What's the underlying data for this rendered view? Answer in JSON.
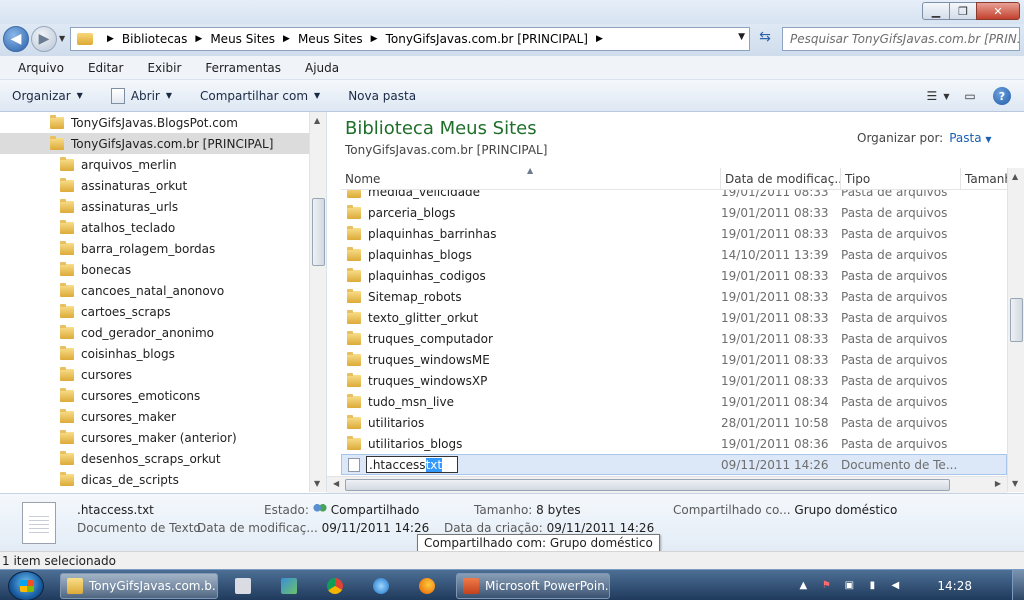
{
  "window": {
    "minimize_glyph": "▁",
    "maximize_glyph": "❐",
    "close_glyph": "✕"
  },
  "address": {
    "crumbs": [
      "Bibliotecas",
      "Meus Sites",
      "Meus Sites",
      "TonyGifsJavas.com.br [PRINCIPAL]"
    ],
    "search_placeholder": "Pesquisar TonyGifsJavas.com.br [PRIN..."
  },
  "menu": [
    "Arquivo",
    "Editar",
    "Exibir",
    "Ferramentas",
    "Ajuda"
  ],
  "commands": {
    "organize": "Organizar",
    "open": "Abrir",
    "share": "Compartilhar com",
    "new_folder": "Nova pasta"
  },
  "navpane": {
    "items": [
      {
        "label": "TonyGifsJavas.BlogsPot.com",
        "level": 1,
        "selected": false
      },
      {
        "label": "TonyGifsJavas.com.br [PRINCIPAL]",
        "level": 1,
        "selected": true
      },
      {
        "label": "arquivos_merlin",
        "level": 2,
        "selected": false
      },
      {
        "label": "assinaturas_orkut",
        "level": 2,
        "selected": false
      },
      {
        "label": "assinaturas_urls",
        "level": 2,
        "selected": false
      },
      {
        "label": "atalhos_teclado",
        "level": 2,
        "selected": false
      },
      {
        "label": "barra_rolagem_bordas",
        "level": 2,
        "selected": false
      },
      {
        "label": "bonecas",
        "level": 2,
        "selected": false
      },
      {
        "label": "cancoes_natal_anonovo",
        "level": 2,
        "selected": false
      },
      {
        "label": "cartoes_scraps",
        "level": 2,
        "selected": false
      },
      {
        "label": "cod_gerador_anonimo",
        "level": 2,
        "selected": false
      },
      {
        "label": "coisinhas_blogs",
        "level": 2,
        "selected": false
      },
      {
        "label": "cursores",
        "level": 2,
        "selected": false
      },
      {
        "label": "cursores_emoticons",
        "level": 2,
        "selected": false
      },
      {
        "label": "cursores_maker",
        "level": 2,
        "selected": false
      },
      {
        "label": "cursores_maker (anterior)",
        "level": 2,
        "selected": false
      },
      {
        "label": "desenhos_scraps_orkut",
        "level": 2,
        "selected": false
      },
      {
        "label": "dicas_de_scripts",
        "level": 2,
        "selected": false
      }
    ]
  },
  "library": {
    "title": "Biblioteca Meus Sites",
    "subtitle": "TonyGifsJavas.com.br [PRINCIPAL]",
    "arrange_label": "Organizar por:",
    "arrange_value": "Pasta"
  },
  "columns": {
    "name": "Nome",
    "date": "Data de modificaç...",
    "type": "Tipo",
    "size": "Tamanh"
  },
  "files": [
    {
      "name": "medida_velicidade",
      "date": "19/01/2011 08:33",
      "type": "Pasta de arquivos",
      "kind": "folder"
    },
    {
      "name": "parceria_blogs",
      "date": "19/01/2011 08:33",
      "type": "Pasta de arquivos",
      "kind": "folder"
    },
    {
      "name": "plaquinhas_barrinhas",
      "date": "19/01/2011 08:33",
      "type": "Pasta de arquivos",
      "kind": "folder"
    },
    {
      "name": "plaquinhas_blogs",
      "date": "14/10/2011 13:39",
      "type": "Pasta de arquivos",
      "kind": "folder"
    },
    {
      "name": "plaquinhas_codigos",
      "date": "19/01/2011 08:33",
      "type": "Pasta de arquivos",
      "kind": "folder"
    },
    {
      "name": "Sitemap_robots",
      "date": "19/01/2011 08:33",
      "type": "Pasta de arquivos",
      "kind": "folder"
    },
    {
      "name": "texto_glitter_orkut",
      "date": "19/01/2011 08:33",
      "type": "Pasta de arquivos",
      "kind": "folder"
    },
    {
      "name": "truques_computador",
      "date": "19/01/2011 08:33",
      "type": "Pasta de arquivos",
      "kind": "folder"
    },
    {
      "name": "truques_windowsME",
      "date": "19/01/2011 08:33",
      "type": "Pasta de arquivos",
      "kind": "folder"
    },
    {
      "name": "truques_windowsXP",
      "date": "19/01/2011 08:33",
      "type": "Pasta de arquivos",
      "kind": "folder"
    },
    {
      "name": "tudo_msn_live",
      "date": "19/01/2011 08:34",
      "type": "Pasta de arquivos",
      "kind": "folder"
    },
    {
      "name": "utilitarios",
      "date": "28/01/2011 10:58",
      "type": "Pasta de arquivos",
      "kind": "folder"
    },
    {
      "name": "utilitarios_blogs",
      "date": "19/01/2011 08:36",
      "type": "Pasta de arquivos",
      "kind": "folder"
    }
  ],
  "renaming": {
    "base": ".htaccess",
    "ext": "txt",
    "date": "09/11/2011 14:26",
    "type": "Documento de Te..."
  },
  "details": {
    "filename": ".htaccess.txt",
    "filetype": "Documento de Texto",
    "state_label": "Estado:",
    "state_value": "Compartilhado",
    "modified_label": "Data de modificaç...",
    "modified_value": "09/11/2011 14:26",
    "size_label": "Tamanho:",
    "size_value": "8 bytes",
    "created_label": "Data da criação:",
    "created_value": "09/11/2011 14:26",
    "shared_label": "Compartilhado co...",
    "shared_value": "Grupo doméstico",
    "tooltip": "Compartilhado com: Grupo doméstico"
  },
  "status": {
    "text": "1 item selecionado"
  },
  "taskbar": {
    "explorer_task": "TonyGifsJavas.com.b...",
    "ppt_task": "Microsoft PowerPoin...",
    "clock": "14:28"
  }
}
